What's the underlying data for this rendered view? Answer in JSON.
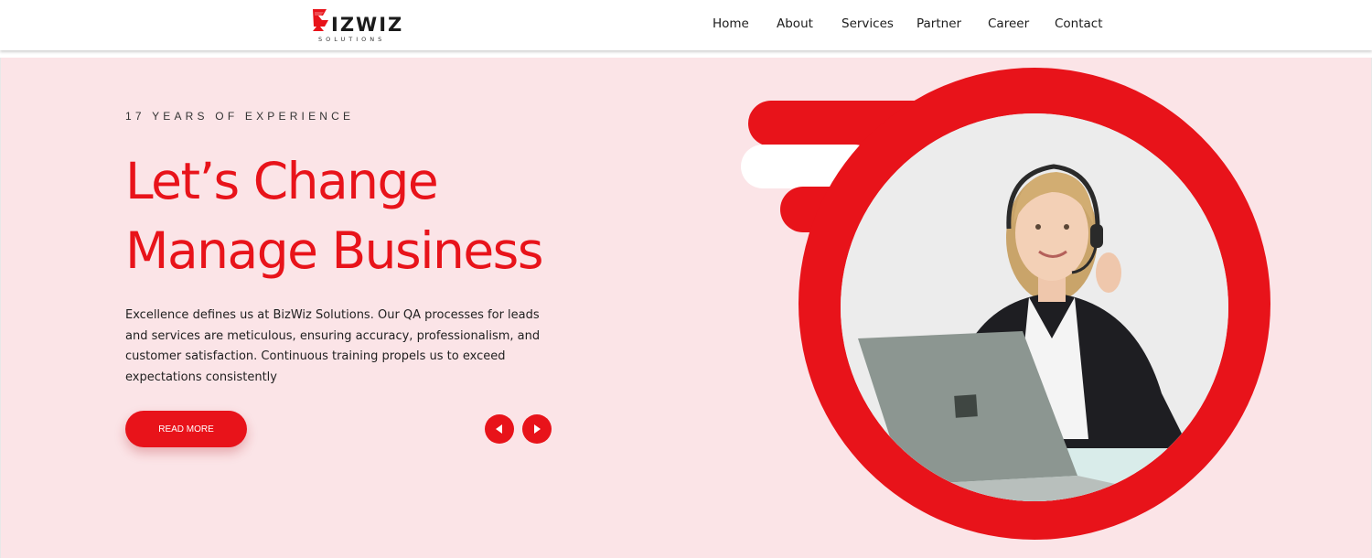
{
  "brand": {
    "name": "IZWIZ",
    "tagline": "SOLUTIONS",
    "accent_color": "#e8131a",
    "logo_mark_icon": "stylized-b-logo"
  },
  "nav": {
    "items": [
      {
        "label": "Home"
      },
      {
        "label": "About"
      },
      {
        "label": "Services"
      },
      {
        "label": "Partner"
      },
      {
        "label": "Career"
      },
      {
        "label": "Contact"
      }
    ]
  },
  "hero": {
    "kicker": "17 YEARS OF EXPERIENCE",
    "headline_line1": "Let’s Change",
    "headline_line2": "Manage Business",
    "description": "Excellence defines us at BizWiz Solutions. Our QA processes for leads and services are meticulous, ensuring accuracy, professionalism, and customer satisfaction. Continuous training propels us to exceed expectations consistently",
    "cta_label": "READ MORE",
    "background_color": "#fbe4e7",
    "prev_icon": "triangle-left-icon",
    "next_icon": "triangle-right-icon",
    "image_description_icon": "support-agent-photo"
  }
}
